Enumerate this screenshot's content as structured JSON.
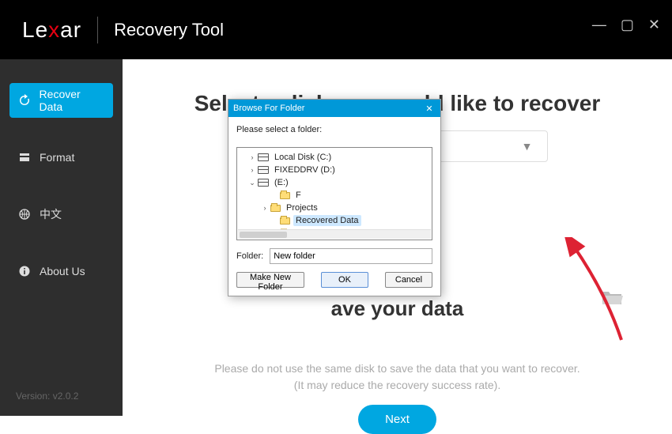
{
  "header": {
    "brand_pre": "Le",
    "brand_x": "x",
    "brand_post": "ar",
    "app_title": "Recovery Tool"
  },
  "window_controls": {
    "min": "—",
    "max": "▢",
    "close": "✕"
  },
  "sidebar": {
    "items": [
      {
        "label": "Recover Data",
        "icon": "recover"
      },
      {
        "label": "Format",
        "icon": "format"
      },
      {
        "label": "中文",
        "icon": "globe"
      },
      {
        "label": "About Us",
        "icon": "info"
      }
    ],
    "version": "Version: v2.0.2"
  },
  "main": {
    "heading1": "Select a disk you would like to recover",
    "heading2_tail": "ave your data",
    "note_line1": "Please do not use the same disk to save the data that you want to recover.",
    "note_line2": "(It may reduce the recovery success rate).",
    "next_label": "Next"
  },
  "dialog": {
    "title": "Browse For Folder",
    "prompt": "Please select a folder:",
    "tree": {
      "c": "Local Disk (C:)",
      "d": "FIXEDDRV (D:)",
      "e": "(E:)",
      "f": "F",
      "projects": "Projects",
      "recovered": "Recovered Data",
      "sketch_cut": "sketch"
    },
    "folder_label": "Folder:",
    "folder_value": "New folder",
    "make_new": "Make New Folder",
    "ok": "OK",
    "cancel": "Cancel"
  }
}
